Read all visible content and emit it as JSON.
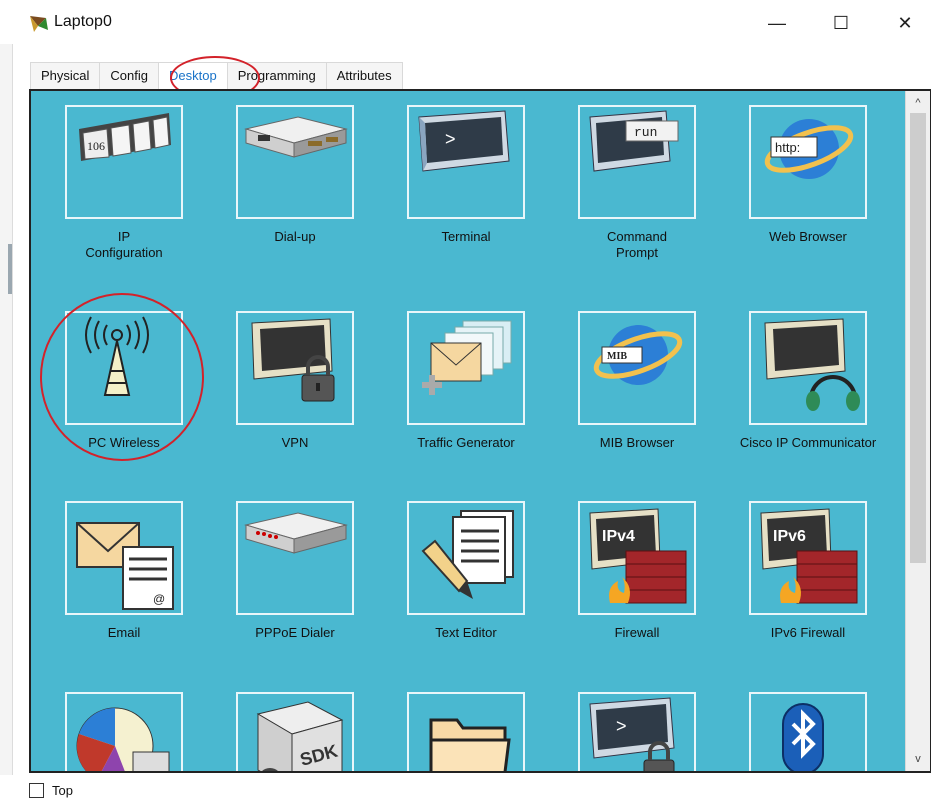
{
  "window": {
    "title": "Laptop0",
    "minimize": "—",
    "maximize": "☐",
    "close": "✕"
  },
  "tabs": [
    "Physical",
    "Config",
    "Desktop",
    "Programming",
    "Attributes"
  ],
  "active_tab": "Desktop",
  "apps": [
    {
      "label": "IP\nConfiguration",
      "icon": "ip-configuration-icon",
      "badge": "106"
    },
    {
      "label": "Dial-up",
      "icon": "dial-up-icon"
    },
    {
      "label": "Terminal",
      "icon": "terminal-icon",
      "badge": ">"
    },
    {
      "label": "Command\nPrompt",
      "icon": "command-prompt-icon",
      "badge": "run"
    },
    {
      "label": "Web Browser",
      "icon": "web-browser-icon",
      "badge": "http:"
    },
    {
      "label": "PC Wireless",
      "icon": "wireless-tower-icon"
    },
    {
      "label": "VPN",
      "icon": "vpn-icon"
    },
    {
      "label": "Traffic Generator",
      "icon": "traffic-generator-icon"
    },
    {
      "label": "MIB Browser",
      "icon": "mib-browser-icon",
      "badge": "MIB"
    },
    {
      "label": "Cisco IP Communicator",
      "icon": "ip-communicator-icon"
    },
    {
      "label": "Email",
      "icon": "email-icon",
      "badge": "@"
    },
    {
      "label": "PPPoE Dialer",
      "icon": "pppoe-dialer-icon"
    },
    {
      "label": "Text Editor",
      "icon": "text-editor-icon"
    },
    {
      "label": "Firewall",
      "icon": "firewall-icon",
      "badge": "IPv4"
    },
    {
      "label": "IPv6 Firewall",
      "icon": "ipv6-firewall-icon",
      "badge": "IPv6"
    },
    {
      "label": "",
      "icon": "pie-chart-icon"
    },
    {
      "label": "",
      "icon": "sdk-icon",
      "badge": "SDK"
    },
    {
      "label": "",
      "icon": "folder-icon"
    },
    {
      "label": "",
      "icon": "terminal-lock-icon",
      "badge": ">"
    },
    {
      "label": "",
      "icon": "bluetooth-icon"
    }
  ],
  "scrollbar": {
    "up": "^",
    "down": "v"
  },
  "bottom": {
    "top_label": "Top",
    "top_checked": false
  },
  "colors": {
    "desktop_bg": "#4ab8d0",
    "accent": "#1a73c8",
    "annotation": "#d3222a"
  }
}
